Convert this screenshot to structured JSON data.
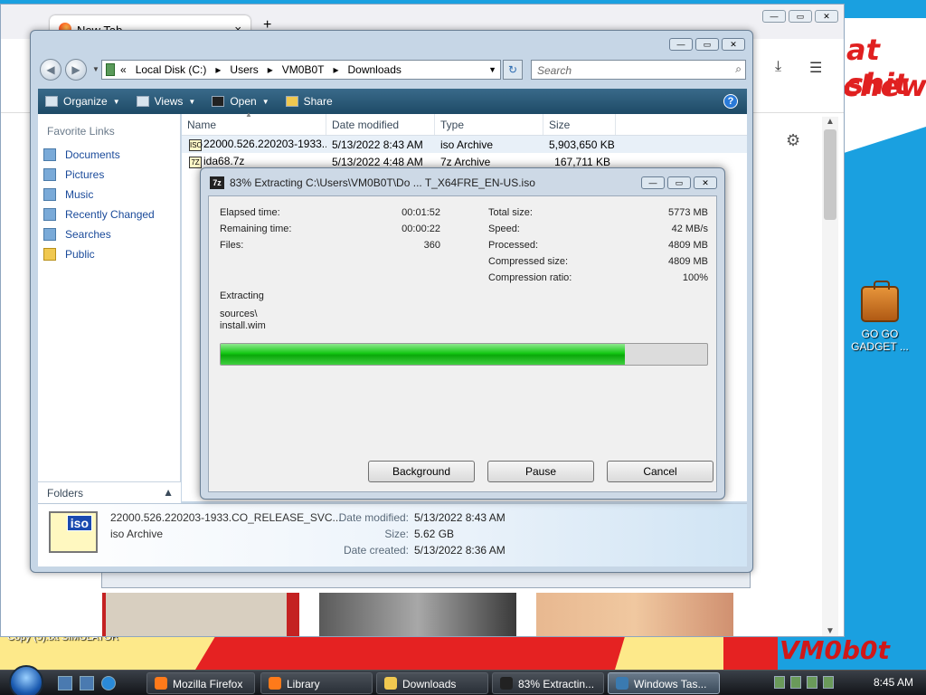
{
  "desktop": {
    "graffiti_line1": "at shit",
    "graffiti_line2": "chew",
    "brand": "VM0b0t",
    "icon_label_1": "GO GO",
    "icon_label_2": "GADGET ...",
    "bottom_label": "Copy (5).txt     SIMULATOR"
  },
  "firefox": {
    "tab_title": "New Tab",
    "tab_close": "×",
    "new_tab": "+"
  },
  "explorer": {
    "breadcrumb_prefix": "«",
    "path": [
      "Local Disk (C:)",
      "Users",
      "VM0B0T",
      "Downloads"
    ],
    "search_placeholder": "Search",
    "toolbar": [
      {
        "label": "Organize",
        "dropdown": true
      },
      {
        "label": "Views",
        "dropdown": true
      },
      {
        "label": "Open",
        "dropdown": true
      },
      {
        "label": "Share",
        "dropdown": false
      }
    ],
    "favorite_links_header": "Favorite Links",
    "favorite_links": [
      "Documents",
      "Pictures",
      "Music",
      "Recently Changed",
      "Searches",
      "Public"
    ],
    "folders_label": "Folders",
    "columns": [
      "Name",
      "Date modified",
      "Type",
      "Size"
    ],
    "files": [
      {
        "icon": "ISO",
        "name": "22000.526.220203-1933...",
        "date": "5/13/2022 8:43 AM",
        "type": "iso Archive",
        "size": "5,903,650 KB"
      },
      {
        "icon": "7Z",
        "name": "ida68.7z",
        "date": "5/13/2022 4:48 AM",
        "type": "7z Archive",
        "size": "167,711 KB"
      }
    ],
    "details": {
      "icon_text": "iso",
      "name": "22000.526.220203-1933.CO_RELEASE_SVC...",
      "type": "iso Archive",
      "date_modified_label": "Date modified:",
      "date_modified": "5/13/2022 8:43 AM",
      "size_label": "Size:",
      "size": "5.62 GB",
      "date_created_label": "Date created:",
      "date_created": "5/13/2022 8:36 AM"
    }
  },
  "zip_dialog": {
    "icon_text": "7z",
    "title": "83% Extracting C:\\Users\\VM0B0T\\Do ... T_X64FRE_EN-US.iso",
    "elapsed_label": "Elapsed time:",
    "elapsed": "00:01:52",
    "remaining_label": "Remaining time:",
    "remaining": "00:00:22",
    "files_label": "Files:",
    "files": "360",
    "total_size_label": "Total size:",
    "total_size": "5773 MB",
    "speed_label": "Speed:",
    "speed": "42 MB/s",
    "processed_label": "Processed:",
    "processed": "4809 MB",
    "compressed_label": "Compressed size:",
    "compressed": "4809 MB",
    "ratio_label": "Compression ratio:",
    "ratio": "100%",
    "extracting_label": "Extracting",
    "current_path": "sources\\",
    "current_file": "install.wim",
    "progress_fraction": 0.83,
    "buttons": {
      "background": "Background",
      "pause": "Pause",
      "cancel": "Cancel"
    }
  },
  "taskbar": {
    "items": [
      {
        "label": "Mozilla Firefox",
        "color": "#ff7a1a",
        "active": false
      },
      {
        "label": "Library",
        "color": "#ff7a1a",
        "active": false
      },
      {
        "label": "Downloads",
        "color": "#f0c850",
        "active": false
      },
      {
        "label": "83% Extractin...",
        "color": "#222222",
        "active": false
      },
      {
        "label": "Windows Tas...",
        "color": "#3a7ab0",
        "active": true
      }
    ],
    "clock": "8:45 AM"
  }
}
